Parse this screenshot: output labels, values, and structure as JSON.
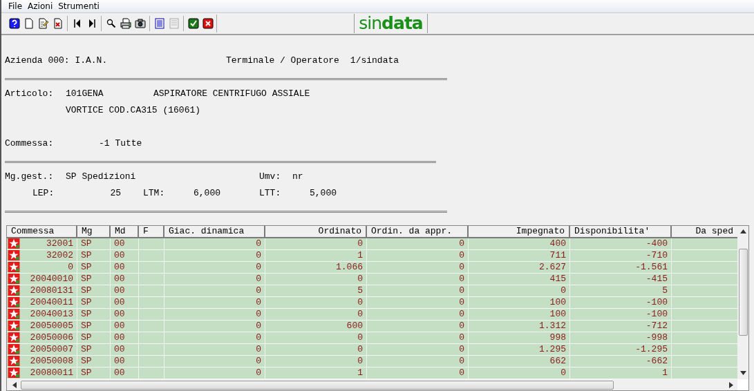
{
  "menu": [
    "File",
    "Azioni",
    "Strumenti"
  ],
  "toolbar": [
    {
      "kind": "help"
    },
    {
      "kind": "new"
    },
    {
      "kind": "edit"
    },
    {
      "kind": "delete"
    },
    {
      "kind": "sep"
    },
    {
      "kind": "prev"
    },
    {
      "kind": "next"
    },
    {
      "kind": "sep"
    },
    {
      "kind": "search"
    },
    {
      "kind": "print"
    },
    {
      "kind": "camera"
    },
    {
      "kind": "sep"
    },
    {
      "kind": "list"
    },
    {
      "kind": "list",
      "disabled": true
    },
    {
      "kind": "sep"
    },
    {
      "kind": "ok"
    },
    {
      "kind": "cancel"
    }
  ],
  "logo": "sin**data**",
  "info": {
    "azienda": "Azienda 000: I.A.N.",
    "terminale_label": "Terminale / Operatore",
    "terminale_value": "1/sindata",
    "articolo_label": "Articolo:",
    "articolo_code": "101GENA",
    "articolo_desc": "ASPIRATORE CENTRIFUGO ASSIALE",
    "articolo_desc2": "VORTICE COD.CA315 (16061)",
    "commessa_label": "Commessa:",
    "commessa_value": "-1 Tutte",
    "mg_label": "Mg.gest.:",
    "mg_value": "SP Spedizioni",
    "umv_label": "Umv:",
    "umv_value": "nr",
    "lep_label": "LEP:",
    "lep_value": "25",
    "ltm_label": "LTM:",
    "ltm_value": "6,000",
    "ltt_label": "LTT:",
    "ltt_value": "5,000"
  },
  "table": {
    "columns": [
      "Commessa",
      "Mg",
      "Md",
      "F",
      "Giac. dinamica",
      "Ordinato",
      "Ordin. da appr.",
      "Impegnato",
      "Disponibilita'",
      "Da sped"
    ],
    "rows": [
      {
        "commessa": "32001",
        "mg": "SP",
        "md": "00",
        "giac": "0",
        "ordinato": "0",
        "ordin_appr": "0",
        "impegnato": "400",
        "disponibilita": "-400"
      },
      {
        "commessa": "32002",
        "mg": "SP",
        "md": "00",
        "giac": "0",
        "ordinato": "1",
        "ordin_appr": "0",
        "impegnato": "711",
        "disponibilita": "-710"
      },
      {
        "commessa": "0",
        "mg": "SP",
        "md": "00",
        "giac": "0",
        "ordinato": "1.066",
        "ordin_appr": "0",
        "impegnato": "2.627",
        "disponibilita": "-1.561"
      },
      {
        "commessa": "20040010",
        "mg": "SP",
        "md": "00",
        "giac": "0",
        "ordinato": "0",
        "ordin_appr": "0",
        "impegnato": "415",
        "disponibilita": "-415"
      },
      {
        "commessa": "20080131",
        "mg": "SP",
        "md": "00",
        "giac": "0",
        "ordinato": "5",
        "ordin_appr": "0",
        "impegnato": "0",
        "disponibilita": "5"
      },
      {
        "commessa": "20040011",
        "mg": "SP",
        "md": "00",
        "giac": "0",
        "ordinato": "0",
        "ordin_appr": "0",
        "impegnato": "100",
        "disponibilita": "-100"
      },
      {
        "commessa": "20040013",
        "mg": "SP",
        "md": "00",
        "giac": "0",
        "ordinato": "0",
        "ordin_appr": "0",
        "impegnato": "100",
        "disponibilita": "-100"
      },
      {
        "commessa": "20050005",
        "mg": "SP",
        "md": "00",
        "giac": "0",
        "ordinato": "600",
        "ordin_appr": "0",
        "impegnato": "1.312",
        "disponibilita": "-712"
      },
      {
        "commessa": "20050006",
        "mg": "SP",
        "md": "00",
        "giac": "0",
        "ordinato": "0",
        "ordin_appr": "0",
        "impegnato": "998",
        "disponibilita": "-998"
      },
      {
        "commessa": "20050007",
        "mg": "SP",
        "md": "00",
        "giac": "0",
        "ordinato": "0",
        "ordin_appr": "0",
        "impegnato": "1.295",
        "disponibilita": "-1.295"
      },
      {
        "commessa": "20050008",
        "mg": "SP",
        "md": "00",
        "giac": "0",
        "ordinato": "0",
        "ordin_appr": "0",
        "impegnato": "662",
        "disponibilita": "-662"
      },
      {
        "commessa": "20080011",
        "mg": "SP",
        "md": "00",
        "giac": "0",
        "ordinato": "1",
        "ordin_appr": "0",
        "impegnato": "0",
        "disponibilita": "1"
      }
    ]
  }
}
